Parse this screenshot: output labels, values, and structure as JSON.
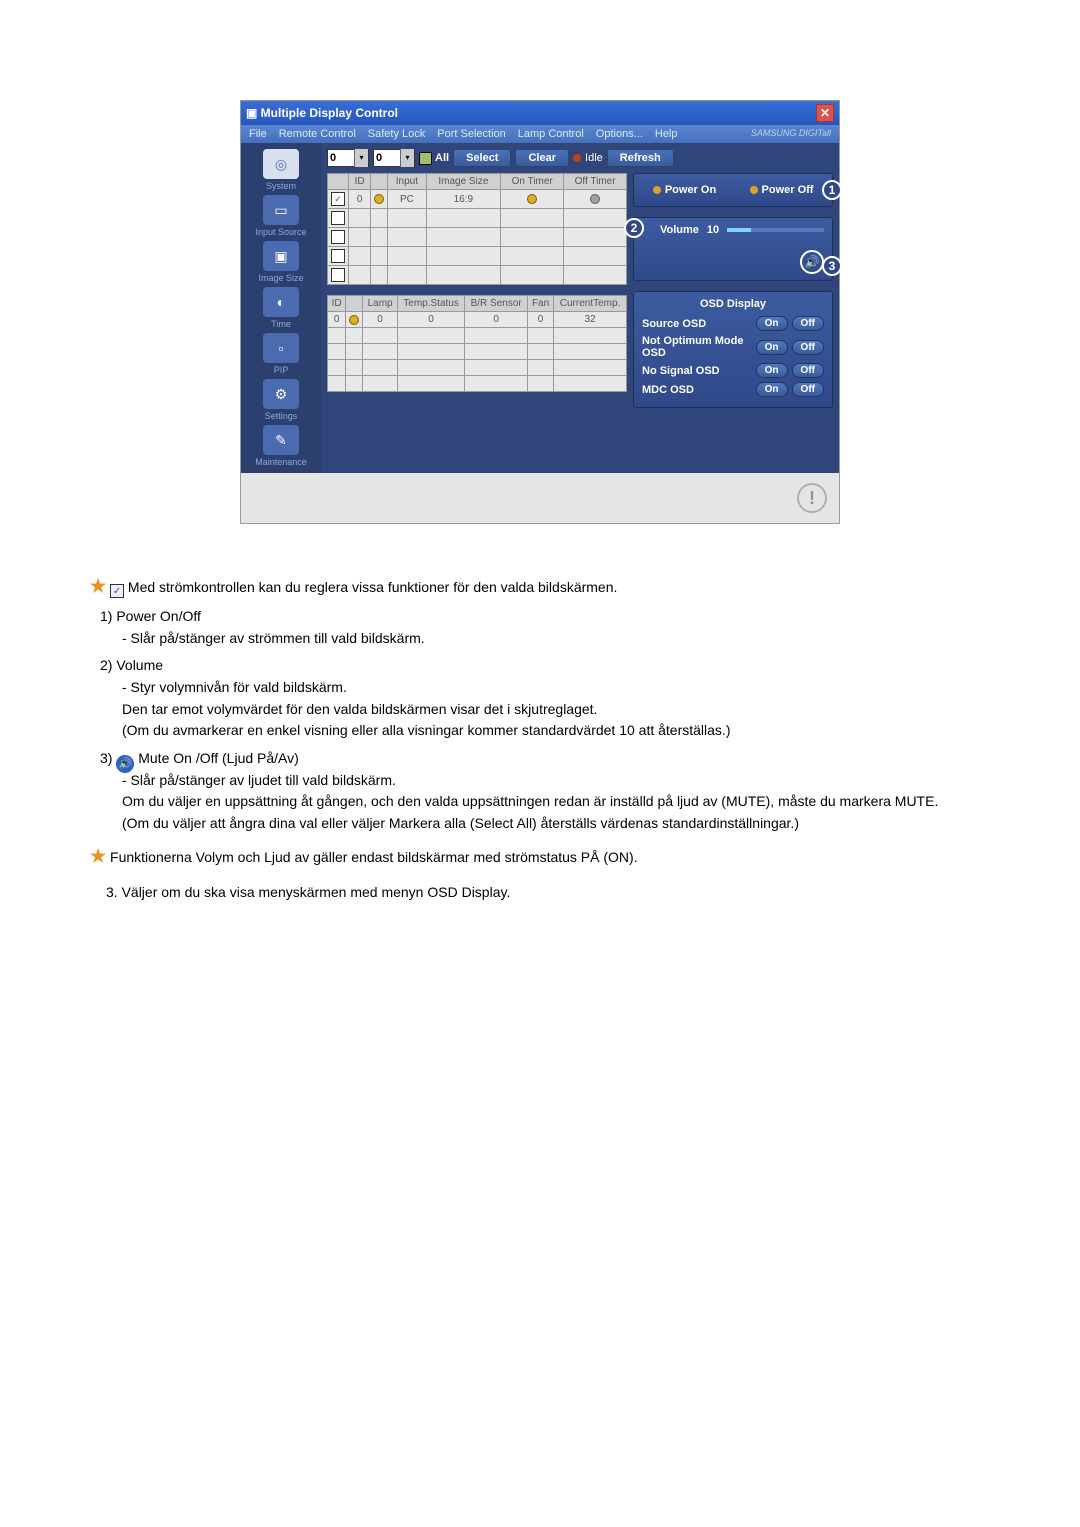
{
  "app": {
    "title": "Multiple Display Control",
    "brand": "SAMSUNG DIGITall"
  },
  "menu": {
    "file": "File",
    "remote": "Remote Control",
    "safety": "Safety Lock",
    "port": "Port Selection",
    "lamp": "Lamp Control",
    "options": "Options...",
    "help": "Help"
  },
  "sidebar": {
    "system": "System",
    "input": "Input Source",
    "image": "Image Size",
    "time": "Time",
    "pip": "PIP",
    "settings": "Settings",
    "maintenance": "Maintenance"
  },
  "toolbar": {
    "combo1": "0",
    "combo2": "0",
    "all": "All",
    "select": "Select",
    "clear": "Clear",
    "idle": "Idle",
    "refresh": "Refresh"
  },
  "table1": {
    "h_id": "ID",
    "h_input": "Input",
    "h_imgsize": "Image Size",
    "h_ontimer": "On Timer",
    "h_offtimer": "Off Timer",
    "r1_id": "0",
    "r1_input": "PC",
    "r1_size": "16:9"
  },
  "table2": {
    "h_id": "ID",
    "h_lamp": "Lamp",
    "h_temp": "Temp.Status",
    "h_brs": "B/R Sensor",
    "h_fan": "Fan",
    "h_curtemp": "CurrentTemp.",
    "r1_id": "0",
    "r1_lamp": "0",
    "r1_ts": "0",
    "r1_brs": "0",
    "r1_fan": "0",
    "r1_ct": "32"
  },
  "power": {
    "on": "Power On",
    "off": "Power Off",
    "badge": "1"
  },
  "volume": {
    "label": "Volume",
    "value": "10",
    "badge_left": "2",
    "badge_right": "3"
  },
  "osd": {
    "title": "OSD Display",
    "rows": {
      "source": "Source OSD",
      "notopt": "Not Optimum Mode OSD",
      "nosignal": "No Signal OSD",
      "mdc": "MDC OSD"
    },
    "on": "On",
    "off": "Off"
  },
  "text": {
    "intro": "Med strömkontrollen kan du reglera vissa funktioner för den valda bildskärmen.",
    "p1_h": "1)  Power On/Off",
    "p1_1": "- Slår på/stänger av strömmen till vald bildskärm.",
    "p2_h": "2)  Volume",
    "p2_1": "- Styr volymnivån för vald bildskärm.",
    "p2_2": "Den tar emot volymvärdet för den valda bildskärmen visar det i skjutreglaget.",
    "p2_3": "(Om du avmarkerar en enkel visning eller alla visningar kommer standardvärdet 10 att återställas.)",
    "p3_lead": "3)",
    "p3_h": "Mute On /Off (Ljud På/Av)",
    "p3_1": "- Slår på/stänger av ljudet till vald bildskärm.",
    "p3_2": "Om du väljer en uppsättning åt gången, och den valda uppsättningen redan är inställd på ljud av (MUTE), måste du markera MUTE.",
    "p3_3": "(Om du väljer att ångra dina val eller väljer Markera alla (Select All) återställs värdenas standardinställningar.)",
    "note": "Funktionerna Volym och Ljud av gäller endast bildskärmar med strömstatus PÅ (ON).",
    "item3": "3. Väljer om du ska visa menyskärmen med menyn OSD Display."
  }
}
